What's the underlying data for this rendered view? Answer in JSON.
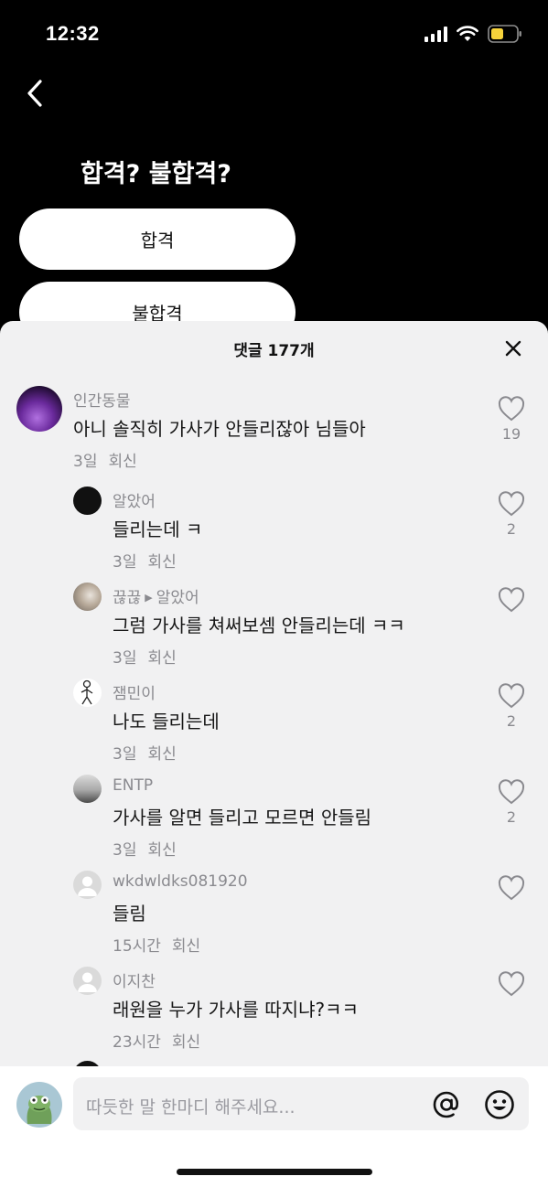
{
  "status_bar": {
    "time": "12:32"
  },
  "question": {
    "title": "합격? 불합격?",
    "options": [
      "합격",
      "불합격"
    ]
  },
  "sheet": {
    "title": "댓글 177개"
  },
  "comments": [
    {
      "username": "인간동물",
      "text": "아니 솔직히 가사가 안들리잖아 님들아",
      "time": "3일",
      "reply": "회신",
      "likes": "19"
    },
    {
      "username": "알았어",
      "text": "들리는데 ㅋ",
      "time": "3일",
      "reply": "회신",
      "likes": "2"
    },
    {
      "username": "끊끊",
      "reply_to": "알았어",
      "text": "그럼 가사를 쳐써보셈 안들리는데 ㅋㅋ",
      "time": "3일",
      "reply": "회신",
      "likes": ""
    },
    {
      "username": "잼민이",
      "text": "나도 들리는데",
      "time": "3일",
      "reply": "회신",
      "likes": "2"
    },
    {
      "username": "ENTP",
      "text": "가사를 알면 들리고 모르면 안들림",
      "time": "3일",
      "reply": "회신",
      "likes": "2"
    },
    {
      "username": "wkdwldks081920",
      "text": "들림",
      "time": "15시간",
      "reply": "회신",
      "likes": ""
    },
    {
      "username": "이지찬",
      "text": "래원을 누가 가사를 따지냐?ㅋㅋ",
      "time": "23시간",
      "reply": "회신",
      "likes": ""
    }
  ],
  "input": {
    "placeholder": "따듯한 말 한마디 해주세요..."
  },
  "icons": {
    "back": "chevron-left-icon",
    "close": "close-icon",
    "like": "heart-outline-icon",
    "mention": "at-sign-icon",
    "emoji": "smiley-icon"
  }
}
